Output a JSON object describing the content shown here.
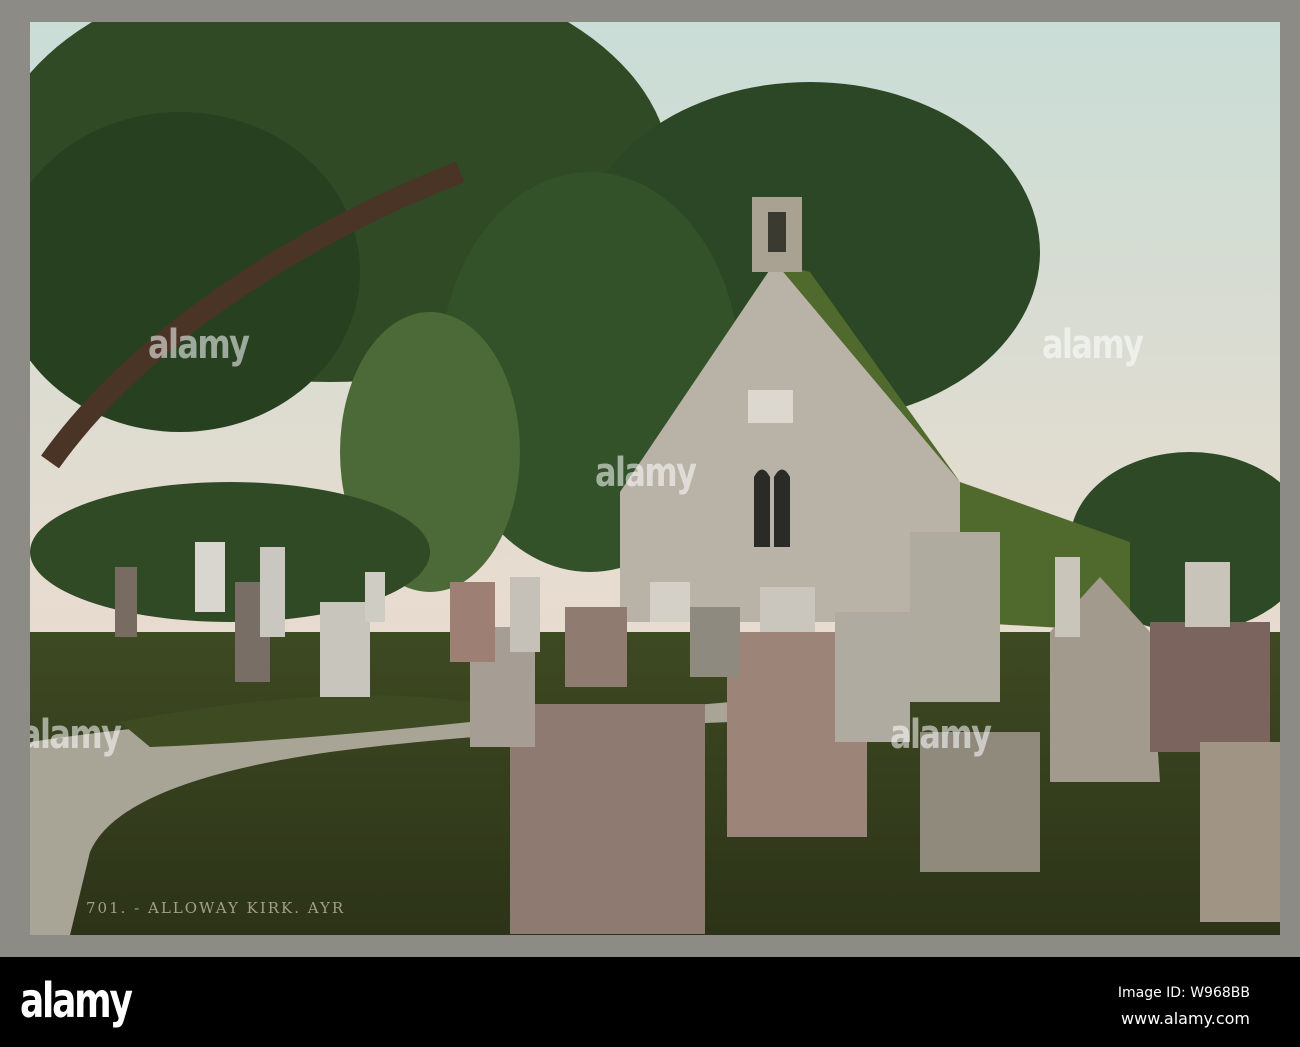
{
  "photo": {
    "caption": "701. - ALLOWAY KIRK. AYR",
    "watermarks": [
      "alamy",
      "alamy",
      "alamy",
      "alamy",
      "alamy"
    ]
  },
  "footer": {
    "logo": "alamy",
    "image_id": "Image ID: W968BB",
    "website": "www.alamy.com"
  }
}
